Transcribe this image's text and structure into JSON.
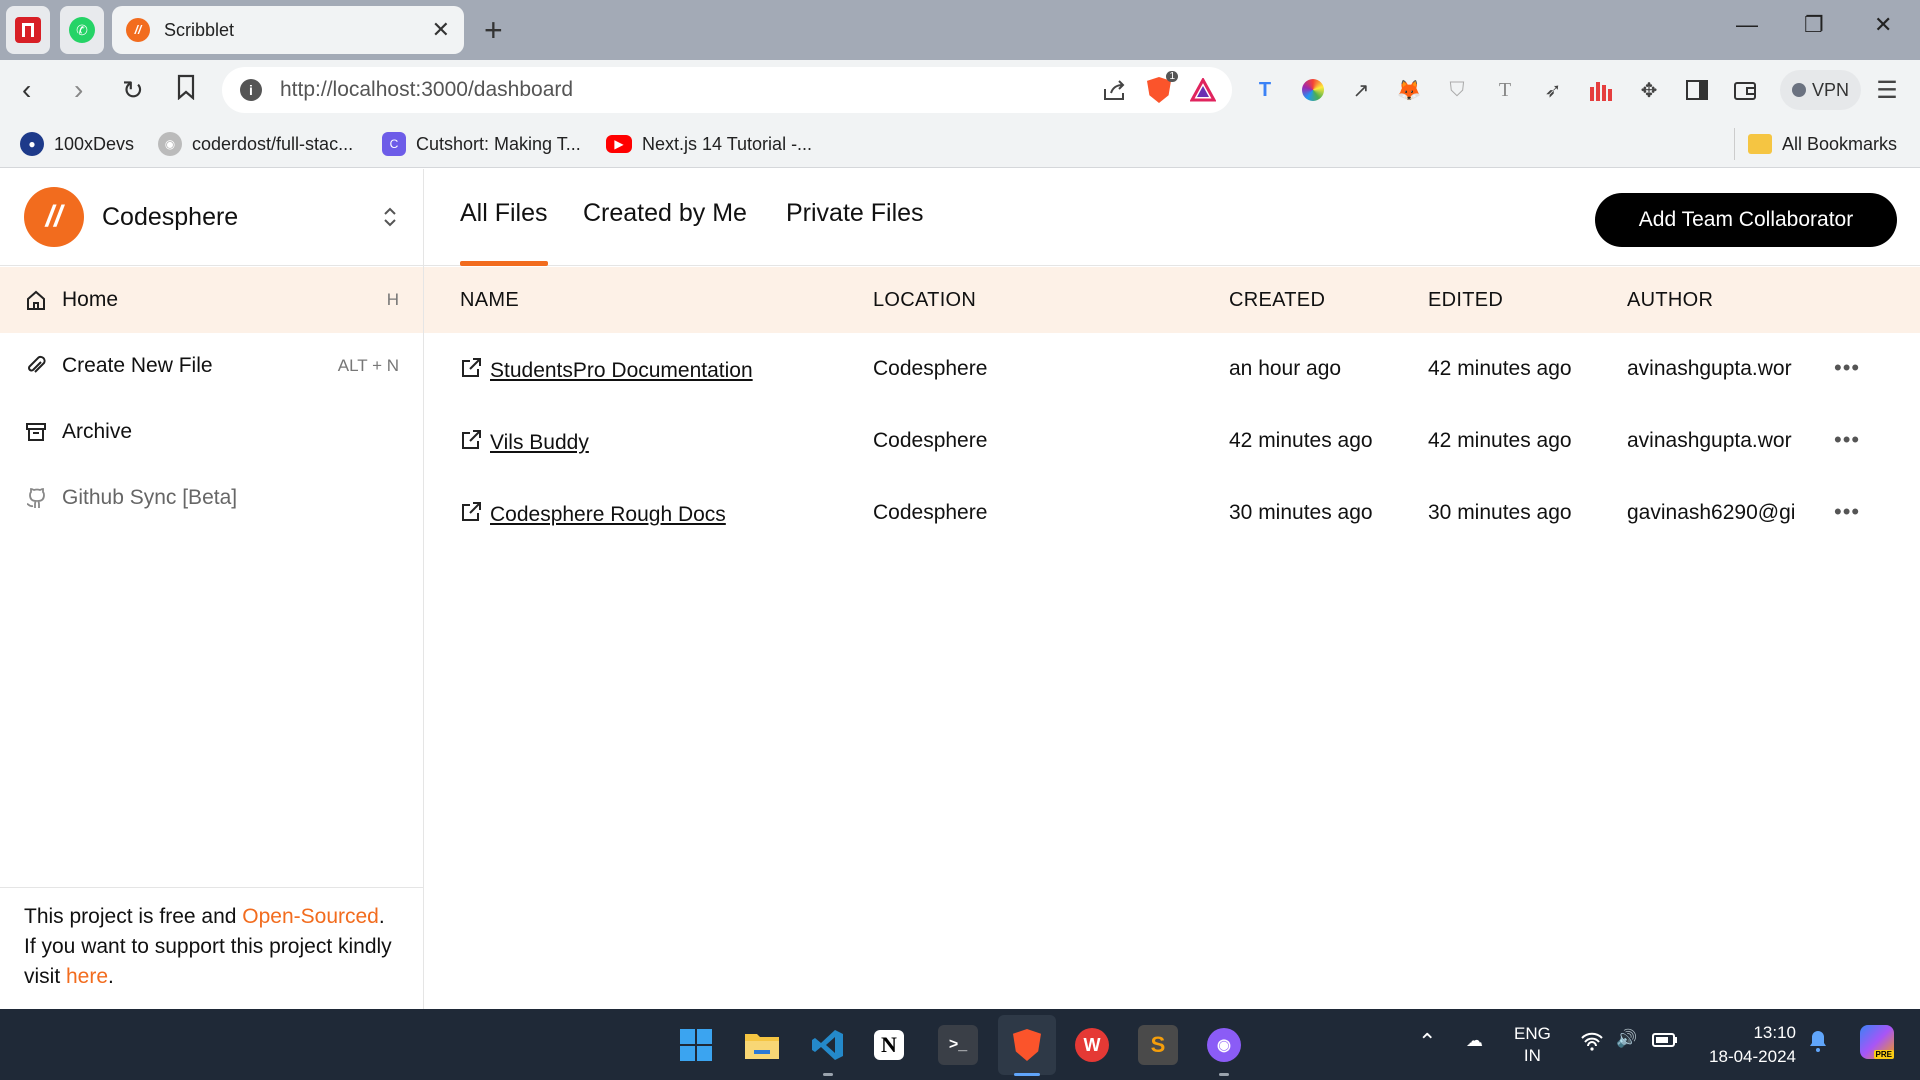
{
  "browser": {
    "tab_title": "Scribblet",
    "tab_favicon": "//",
    "new_tab": "+",
    "url": "http://localhost:3000/dashboard",
    "vpn_label": "VPN",
    "brave_badge": "1",
    "window_controls": {
      "minimize": "—",
      "restore": "❐",
      "close": "✕"
    }
  },
  "bookmarks": [
    {
      "label": "100xDevs",
      "icon": "avatar-icon"
    },
    {
      "label": "coderdost/full-stac...",
      "icon": "github-icon"
    },
    {
      "label": "Cutshort: Making T...",
      "icon": "cutshort-icon"
    },
    {
      "label": "Next.js 14 Tutorial -...",
      "icon": "youtube-icon"
    }
  ],
  "all_bookmarks": "All Bookmarks",
  "sidebar": {
    "brand_logo": "//",
    "brand_name": "Codesphere",
    "items": [
      {
        "label": "Home",
        "shortcut": "H",
        "icon": "home-icon"
      },
      {
        "label": "Create New File",
        "shortcut": "ALT + N",
        "icon": "paperclip-icon"
      },
      {
        "label": "Archive",
        "shortcut": "",
        "icon": "archive-icon"
      },
      {
        "label": "Github Sync [Beta]",
        "shortcut": "",
        "icon": "github-icon"
      }
    ],
    "footer": {
      "text1": "This project is free and ",
      "link1": "Open-Sourced",
      "text2": ". If you want to support this project kindly visit ",
      "link2": "here",
      "text3": "."
    }
  },
  "main": {
    "tabs": [
      "All Files",
      "Created by Me",
      "Private Files"
    ],
    "add_button": "Add Team Collaborator",
    "columns": [
      "NAME",
      "LOCATION",
      "CREATED",
      "EDITED",
      "AUTHOR"
    ],
    "rows": [
      {
        "name": "StudentsPro Documentation",
        "location": "Codesphere",
        "created": "an hour ago",
        "edited": "42 minutes ago",
        "author": "avinashgupta.wor"
      },
      {
        "name": "Vils Buddy",
        "location": "Codesphere",
        "created": "42 minutes ago",
        "edited": "42 minutes ago",
        "author": "avinashgupta.wor"
      },
      {
        "name": "Codesphere Rough Docs",
        "location": "Codesphere",
        "created": "30 minutes ago",
        "edited": "30 minutes ago",
        "author": "gavinash6290@gi"
      }
    ],
    "more_label": "•••"
  },
  "taskbar": {
    "lang_top": "ENG",
    "lang_bottom": "IN",
    "time": "13:10",
    "date": "18-04-2024"
  },
  "colors": {
    "accent": "#f26c1e",
    "highlight": "#fdf1e7",
    "button": "#000000",
    "taskbar": "#1f2937"
  }
}
